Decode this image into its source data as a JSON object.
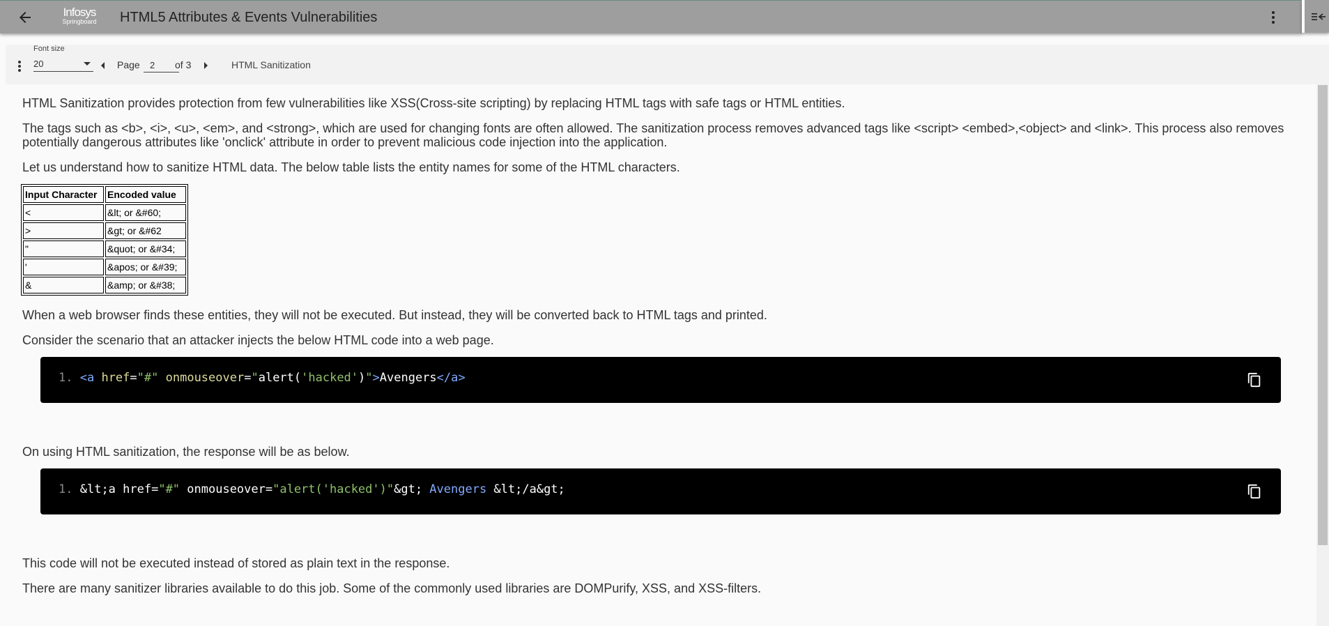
{
  "header": {
    "title": "HTML5 Attributes & Events Vulnerabilities",
    "logo_line1": "Infosys",
    "logo_line2": "Springboard"
  },
  "toolbar": {
    "font_size_label": "Font size",
    "font_size_value": "20",
    "page_label": "Page",
    "page_value": "2",
    "of_label": "of 3",
    "section_title": "HTML Sanitization"
  },
  "content": {
    "p1": "HTML Sanitization provides protection from few vulnerabilities like XSS(Cross-site scripting) by replacing HTML tags with safe tags or HTML entities.",
    "p2": "The tags such as <b>, <i>, <u>, <em>, and <strong>, which are used for changing fonts are often allowed. The sanitization process removes advanced tags like <script> <embed>,<object> and <link>. This process also removes potentially dangerous attributes like 'onclick' attribute in order to prevent malicious code injection into the application.",
    "p3": "Let us understand how to sanitize HTML data. The below table lists the entity names for some of the HTML characters.",
    "table": {
      "headers": [
        "Input Character",
        "Encoded value"
      ],
      "rows": [
        [
          "<",
          "&lt; or &#60;"
        ],
        [
          ">",
          "&gt; or &#62"
        ],
        [
          "\"",
          "&quot; or &#34;"
        ],
        [
          "'",
          "&apos; or &#39;"
        ],
        [
          "&",
          "&amp; or &#38;"
        ]
      ]
    },
    "p4": "When a web browser finds these entities, they will not be executed. But instead, they will be converted back to HTML tags and printed.",
    "p5": "Consider the scenario that an attacker injects the below HTML code into a web page.",
    "code1": {
      "num": "1.",
      "t1": "<a ",
      "a1": "href",
      "eq1": "=",
      "s1": "\"#\"",
      "sp": " ",
      "a2": "onmouseover",
      "eq2": "=",
      "s2a": "\"",
      "s2b": "alert(",
      "s2c": "'hacked'",
      "s2d": ")",
      "s2e": "\"",
      "t2": ">",
      "txt": "Avengers",
      "t3": "</a>"
    },
    "p6": "On using HTML sanitization, the response will be as below.",
    "code2": {
      "num": "1.",
      "a": "&lt;a href=",
      "s1": "\"#\"",
      "b": " onmouseover=",
      "s2": "\"alert('hacked')\"",
      "c": "&gt; ",
      "t": "Avengers",
      "d": " &lt;/a&gt;"
    },
    "p7": "This code will not be executed instead of stored as plain text in the response.",
    "p8": "There are many sanitizer libraries available to do this job. Some of the commonly used libraries are DOMPurify, XSS, and XSS-filters."
  }
}
